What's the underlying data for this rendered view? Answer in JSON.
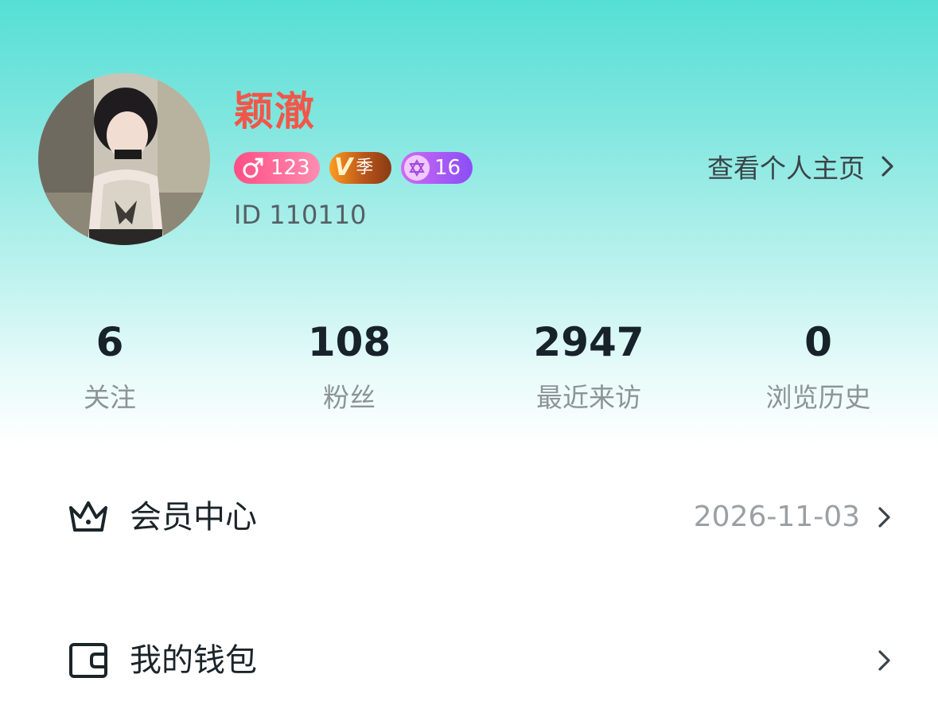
{
  "profile": {
    "name": "颖澈",
    "badges": {
      "gender_symbol": "♂",
      "gender_value": "123",
      "vip_mark": "V",
      "vip_label": "季",
      "level_value": "16"
    },
    "id_text": "ID 110110",
    "view_profile_label": "查看个人主页"
  },
  "stats": [
    {
      "value": "6",
      "label": "关注"
    },
    {
      "value": "108",
      "label": "粉丝"
    },
    {
      "value": "2947",
      "label": "最近来访"
    },
    {
      "value": "0",
      "label": "浏览历史"
    }
  ],
  "menu": {
    "membership": {
      "label": "会员中心",
      "value": "2026-11-03",
      "icon": "crown-icon"
    },
    "wallet": {
      "label": "我的钱包",
      "icon": "wallet-icon"
    }
  },
  "colors": {
    "header_top": "#55dfd5",
    "name": "#f0574a",
    "gender_badge": "#ff4e85",
    "vip_badge": "#b9561a",
    "level_badge": "#8a4ef5"
  }
}
